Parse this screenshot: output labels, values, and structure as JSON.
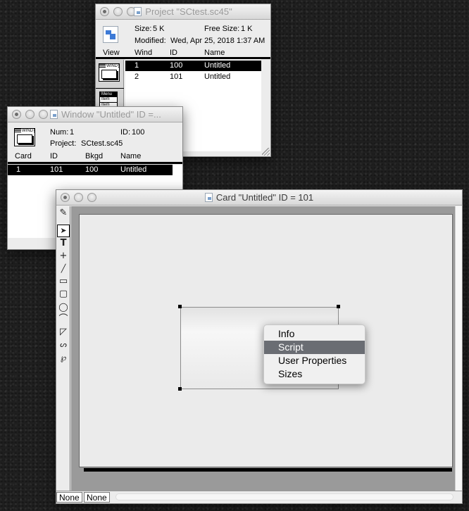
{
  "project": {
    "title": "Project \"SCtest.sc45\"",
    "size_label": "Size:",
    "size_value": "5 K",
    "free_label": "Free Size:",
    "free_value": "1 K",
    "modified_label": "Modified:",
    "modified_value": "Wed, Apr 25, 2018 1:37 AM",
    "view_label": "View",
    "columns": [
      "Wind",
      "ID",
      "Name"
    ],
    "rows": [
      {
        "wind": "1",
        "id": "100",
        "name": "Untitled",
        "selected": true
      },
      {
        "wind": "2",
        "id": "101",
        "name": "Untitled",
        "selected": false
      }
    ],
    "palette": {
      "wind_label": "WIND",
      "menu_header": "Menu",
      "menu_items": [
        "Item",
        "Item"
      ]
    }
  },
  "window": {
    "title": "Window \"Untitled\" ID =...",
    "num_label": "Num:",
    "num_value": "1",
    "id_label": "ID:",
    "id_value": "100",
    "project_label": "Project:",
    "project_value": "SCtest.sc45",
    "icon_label": "WIND",
    "columns": [
      "Card",
      "ID",
      "Bkgd",
      "Name"
    ],
    "rows": [
      {
        "card": "1",
        "id": "101",
        "bkgd": "100",
        "name": "Untitled",
        "selected": true
      }
    ]
  },
  "card": {
    "title": "Card \"Untitled\" ID = 101",
    "status": [
      "None",
      "None"
    ],
    "tools": [
      {
        "name": "browse-tool-icon",
        "glyph": "✎"
      },
      {
        "name": "arrow-tool-icon",
        "glyph": "➤"
      },
      {
        "name": "text-tool-icon",
        "glyph": "T"
      },
      {
        "name": "crosshair-tool-icon",
        "glyph": "+"
      },
      {
        "name": "line-tool-icon",
        "glyph": "╱"
      },
      {
        "name": "rectangle-tool-icon",
        "glyph": "▭"
      },
      {
        "name": "rounded-rect-tool-icon",
        "glyph": "▢"
      },
      {
        "name": "oval-tool-icon",
        "glyph": "◯"
      },
      {
        "name": "curve-tool-icon",
        "glyph": "⌒"
      },
      {
        "name": "polygon-tool-icon",
        "glyph": "◸"
      },
      {
        "name": "freehand-tool-icon",
        "glyph": "ᔕ"
      },
      {
        "name": "lasso-tool-icon",
        "glyph": "℘"
      }
    ]
  },
  "context_menu": {
    "items": [
      {
        "label": "Info",
        "selected": false
      },
      {
        "label": "Script",
        "selected": true
      },
      {
        "label": "User Properties",
        "selected": false
      },
      {
        "label": "Sizes",
        "selected": false
      }
    ]
  }
}
